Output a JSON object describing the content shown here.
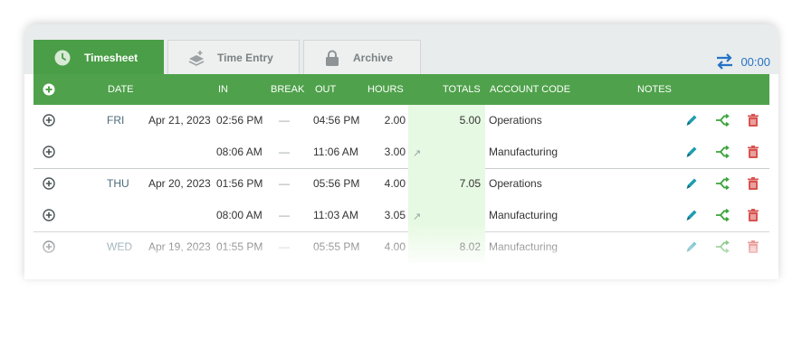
{
  "tabs": [
    {
      "label": "Timesheet",
      "icon": "clock-icon",
      "active": true
    },
    {
      "label": "Time Entry",
      "icon": "stack-icon",
      "active": false
    },
    {
      "label": "Archive",
      "icon": "lock-icon",
      "active": false
    }
  ],
  "sync": {
    "icon": "swap-arrows-icon",
    "time": "00:00"
  },
  "columns": {
    "date": "DATE",
    "in": "IN",
    "break": "BREAK",
    "out": "OUT",
    "hours": "HOURS",
    "totals": "TOTALS",
    "account_code": "ACCOUNT CODE",
    "notes": "NOTES"
  },
  "rows": [
    {
      "day": "FRI",
      "date": "Apr 21, 2023",
      "in": "02:56 PM",
      "break": "—",
      "out": "04:56 PM",
      "hours": "2.00",
      "total": "5.00",
      "account": "Operations",
      "note_marker": ""
    },
    {
      "day": "",
      "date": "",
      "in": "08:06 AM",
      "break": "—",
      "out": "11:06 AM",
      "hours": "3.00",
      "total": "",
      "account": "Manufacturing",
      "note_marker": "↗"
    },
    {
      "day": "THU",
      "date": "Apr 20, 2023",
      "in": "01:56 PM",
      "break": "—",
      "out": "05:56 PM",
      "hours": "4.00",
      "total": "7.05",
      "account": "Operations",
      "note_marker": ""
    },
    {
      "day": "",
      "date": "",
      "in": "08:00 AM",
      "break": "—",
      "out": "11:03 AM",
      "hours": "3.05",
      "total": "",
      "account": "Manufacturing",
      "note_marker": "↗"
    },
    {
      "day": "WED",
      "date": "Apr 19, 2023",
      "in": "01:55 PM",
      "break": "—",
      "out": "05:55 PM",
      "hours": "4.00",
      "total": "8.02",
      "account": "Manufacturing",
      "note_marker": ""
    }
  ],
  "colors": {
    "accent_green": "#4fa24b",
    "totals_bg": "#e6f9e2",
    "edit_icon": "#1f9bb1",
    "split_icon": "#3aa43a",
    "delete_icon": "#d9534f",
    "link_blue": "#2573c6"
  }
}
